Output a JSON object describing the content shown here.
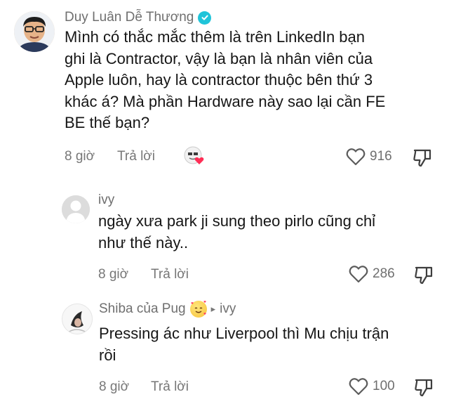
{
  "comments": [
    {
      "username": "Duy Luân Dễ Thương",
      "verified": true,
      "lines": [
        "Mình có thắc mắc thêm là trên LinkedIn bạn",
        "ghi là Contractor, vậy là bạn là nhân viên của",
        "Apple luôn, hay là contractor thuộc bên thứ 3",
        "khác á? Mà phần Hardware này sao lại cần FE",
        "BE thế bạn?"
      ],
      "time": "8 giờ",
      "reply_label": "Trả lời",
      "likes": "916",
      "creator_liked": true
    },
    {
      "username": "ivy",
      "lines": [
        "ngày xưa park ji sung theo pirlo cũng chỉ",
        "như thế này.."
      ],
      "time": "8 giờ",
      "reply_label": "Trả lời",
      "likes": "286"
    },
    {
      "username": "Shiba của Pug",
      "reply_to": "ivy",
      "reply_arrow": "▸",
      "lines": [
        "Pressing ác như Liverpool thì Mu chịu trận",
        "rồi"
      ],
      "time": "8 giờ",
      "reply_label": "Trả lời",
      "likes": "100"
    }
  ],
  "colors": {
    "verified_badge": "#20c4d9",
    "heart": "#ff2d55",
    "muted_text": "#777777"
  },
  "icons": [
    "verified-icon",
    "creator-heart-avatar-icon",
    "heart-outline-icon",
    "dislike-icon",
    "smiling-hearts-emoji-icon",
    "reply-arrow-icon"
  ]
}
